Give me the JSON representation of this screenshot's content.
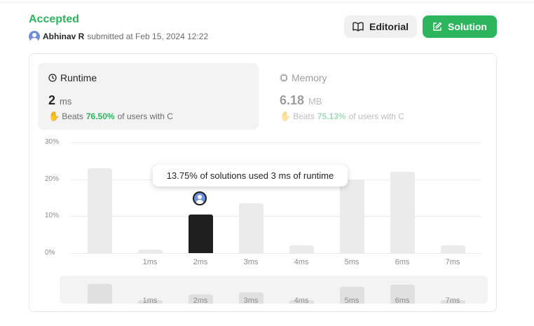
{
  "submission": {
    "status": "Accepted",
    "user": "Abhinav R",
    "submitted_text": "submitted at Feb 15, 2024 12:22"
  },
  "buttons": {
    "editorial": "Editorial",
    "solution": "Solution"
  },
  "runtime": {
    "title": "Runtime",
    "value": "2",
    "unit": "ms",
    "beats_label": "Beats",
    "beats_pct": "76.50%",
    "beats_suffix": "of users with C"
  },
  "memory": {
    "title": "Memory",
    "value": "6.18",
    "unit": "MB",
    "beats_label": "Beats",
    "beats_pct": "75.13%",
    "beats_suffix": "of users with C"
  },
  "tooltip": "13.75% of solutions used 3 ms of runtime",
  "colors": {
    "accent_green": "#2db55d",
    "bar_default": "#ebebeb",
    "bar_active": "#1f1f1f"
  },
  "chart_data": {
    "type": "bar",
    "y_ticks": [
      "30%",
      "20%",
      "10%",
      "0%"
    ],
    "ylim": [
      0,
      30
    ],
    "categories": [
      "",
      "1ms",
      "2ms",
      "3ms",
      "4ms",
      "5ms",
      "6ms",
      "7ms"
    ],
    "values": [
      23,
      1,
      10.5,
      13.5,
      2,
      20,
      22,
      2
    ],
    "highlighted_category": "2ms"
  }
}
